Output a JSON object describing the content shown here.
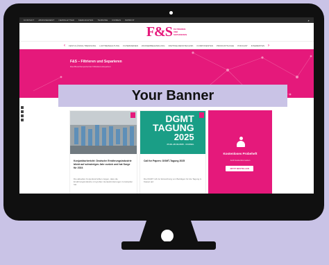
{
  "topbar": {
    "items": [
      "KONTAKT",
      "ABONNEMENT",
      "NEWSLETTER",
      "MEDIADATEN",
      "TERMINE",
      "FIRMEN",
      "IMPRINT"
    ],
    "search_icon": "search-icon"
  },
  "logo": {
    "text": "F&S",
    "sub_line1": "FILTRIEREN",
    "sub_line2": "UND",
    "sub_line3": "SEPARIEREN"
  },
  "nav": {
    "items": [
      "FEST-FLÜSSIG-TRENNUNG",
      "LUFTREINHALTUNG",
      "FILTERMEDIEN",
      "WASSERBEHANDLUNG",
      "PARTIKELMESSTECHNIK",
      "KOMPONENTEN",
      "PRODUKTSUCHE",
      "PODCAST",
      "INSERENTEN"
    ],
    "prev_icon": "chevron-left-icon",
    "next_icon": "chevron-right-icon"
  },
  "hero": {
    "title": "F&S – Filtrieren und Separieren",
    "subtitle": "Das Branchenportal der Filtrations-Experten"
  },
  "banner": {
    "text": "Your Banner"
  },
  "cards": [
    {
      "title": "Konjunkturbericht: Deutsche Ernährungsindustrie blickt auf schwieriges Jahr zurück und hat Sorge für 2024",
      "body": "Die aktuellen Konjunkturzahlen zeigen, dass die Ernährungsindustrie mit großen Herausforderungen zu kämpfen hat."
    },
    {
      "image_line1": "DGMT",
      "image_line2": "TAGUNG",
      "image_line3": "2025",
      "image_meta": "25.09.-26.09.2025 · KASSEL",
      "title": "Call for Papers: DGMT-Tagung 2025",
      "body": "Die DGMT ruft zur Einreichung von Beiträgen für die Tagung in Kassel auf."
    }
  ],
  "promo": {
    "title": "Kostenloses Probeheft",
    "subtitle": "Jetzt kostenlos testen",
    "button": "JETZT BESTELLEN"
  },
  "colors": {
    "brand": "#e5197b",
    "banner": "#c9c3e6",
    "frame": "#101010",
    "teal": "#1a9e86"
  }
}
